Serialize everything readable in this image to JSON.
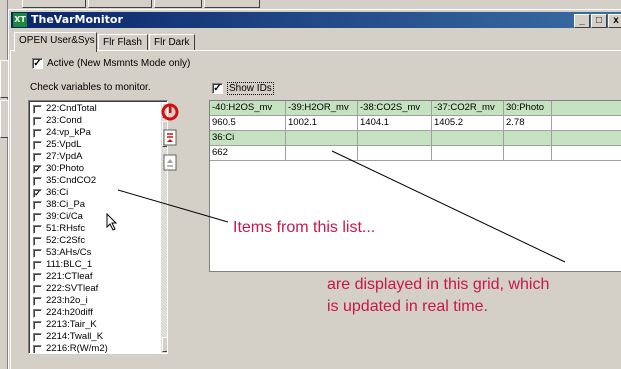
{
  "window": {
    "title": "TheVarMonitor",
    "app_icon": "XT",
    "buttons": {
      "minimize": "_",
      "maximize": "□",
      "close": "x"
    }
  },
  "tabs": [
    {
      "label": "OPEN User&Sys",
      "active": true
    },
    {
      "label": "Flr Flash",
      "active": false
    },
    {
      "label": "Flr Dark",
      "active": false
    }
  ],
  "active_checkbox": {
    "label": "Active (New Msmnts Mode only)",
    "checked": true
  },
  "list_caption": "Check variables to monitor.",
  "show_ids": {
    "label": "Show IDs",
    "checked": true
  },
  "variables": [
    {
      "label": "22:CndTotal",
      "checked": false
    },
    {
      "label": "23:Cond",
      "checked": false
    },
    {
      "label": "24:vp_kPa",
      "checked": false
    },
    {
      "label": "25:VpdL",
      "checked": false
    },
    {
      "label": "27:VpdA",
      "checked": false
    },
    {
      "label": "30:Photo",
      "checked": true
    },
    {
      "label": "35:CndCO2",
      "checked": false
    },
    {
      "label": "36:Ci",
      "checked": true
    },
    {
      "label": "38:Ci_Pa",
      "checked": false
    },
    {
      "label": "39:Ci/Ca",
      "checked": false
    },
    {
      "label": "51:RHsfc",
      "checked": false
    },
    {
      "label": "52:C2Sfc",
      "checked": false
    },
    {
      "label": "53:AHs/Cs",
      "checked": false
    },
    {
      "label": "111:BLC_1",
      "checked": false
    },
    {
      "label": "221:CTleaf",
      "checked": false
    },
    {
      "label": "222:SVTleaf",
      "checked": false
    },
    {
      "label": "223:h2o_i",
      "checked": false
    },
    {
      "label": "224:h20diff",
      "checked": false
    },
    {
      "label": "2213:Tair_K",
      "checked": false
    },
    {
      "label": "2214:Twall_K",
      "checked": false
    },
    {
      "label": "2216:R(W/m2)",
      "checked": false
    }
  ],
  "scroll_arrows": {
    "up": "▲",
    "down": "▼"
  },
  "icons": {
    "clear": "clear-red-icon",
    "copy_up": "copy-icon",
    "copy_down": "paste-icon"
  },
  "grid": {
    "rows": [
      {
        "highlight": true,
        "cells": [
          "-40:H2OS_mv",
          "-39:H2OR_mv",
          "-38:CO2S_mv",
          "-37:CO2R_mv",
          "30:Photo"
        ]
      },
      {
        "highlight": false,
        "cells": [
          "960.5",
          "1002.1",
          "1404.1",
          "1405.2",
          "2.78"
        ]
      },
      {
        "highlight": true,
        "cells": [
          "36:Ci",
          "",
          "",
          "",
          ""
        ]
      },
      {
        "highlight": false,
        "cells": [
          "662",
          "",
          "",
          "",
          ""
        ]
      }
    ]
  },
  "annotations": {
    "list_note": "Items from this list...",
    "grid_note_line1": "are displayed in this grid, which",
    "grid_note_line2": "is updated in real time."
  },
  "colors": {
    "title_gradient_start": "#0a246a",
    "title_gradient_end": "#3a6ea5",
    "grid_highlight": "#c4e2c0",
    "annotation": "#c8174a"
  }
}
